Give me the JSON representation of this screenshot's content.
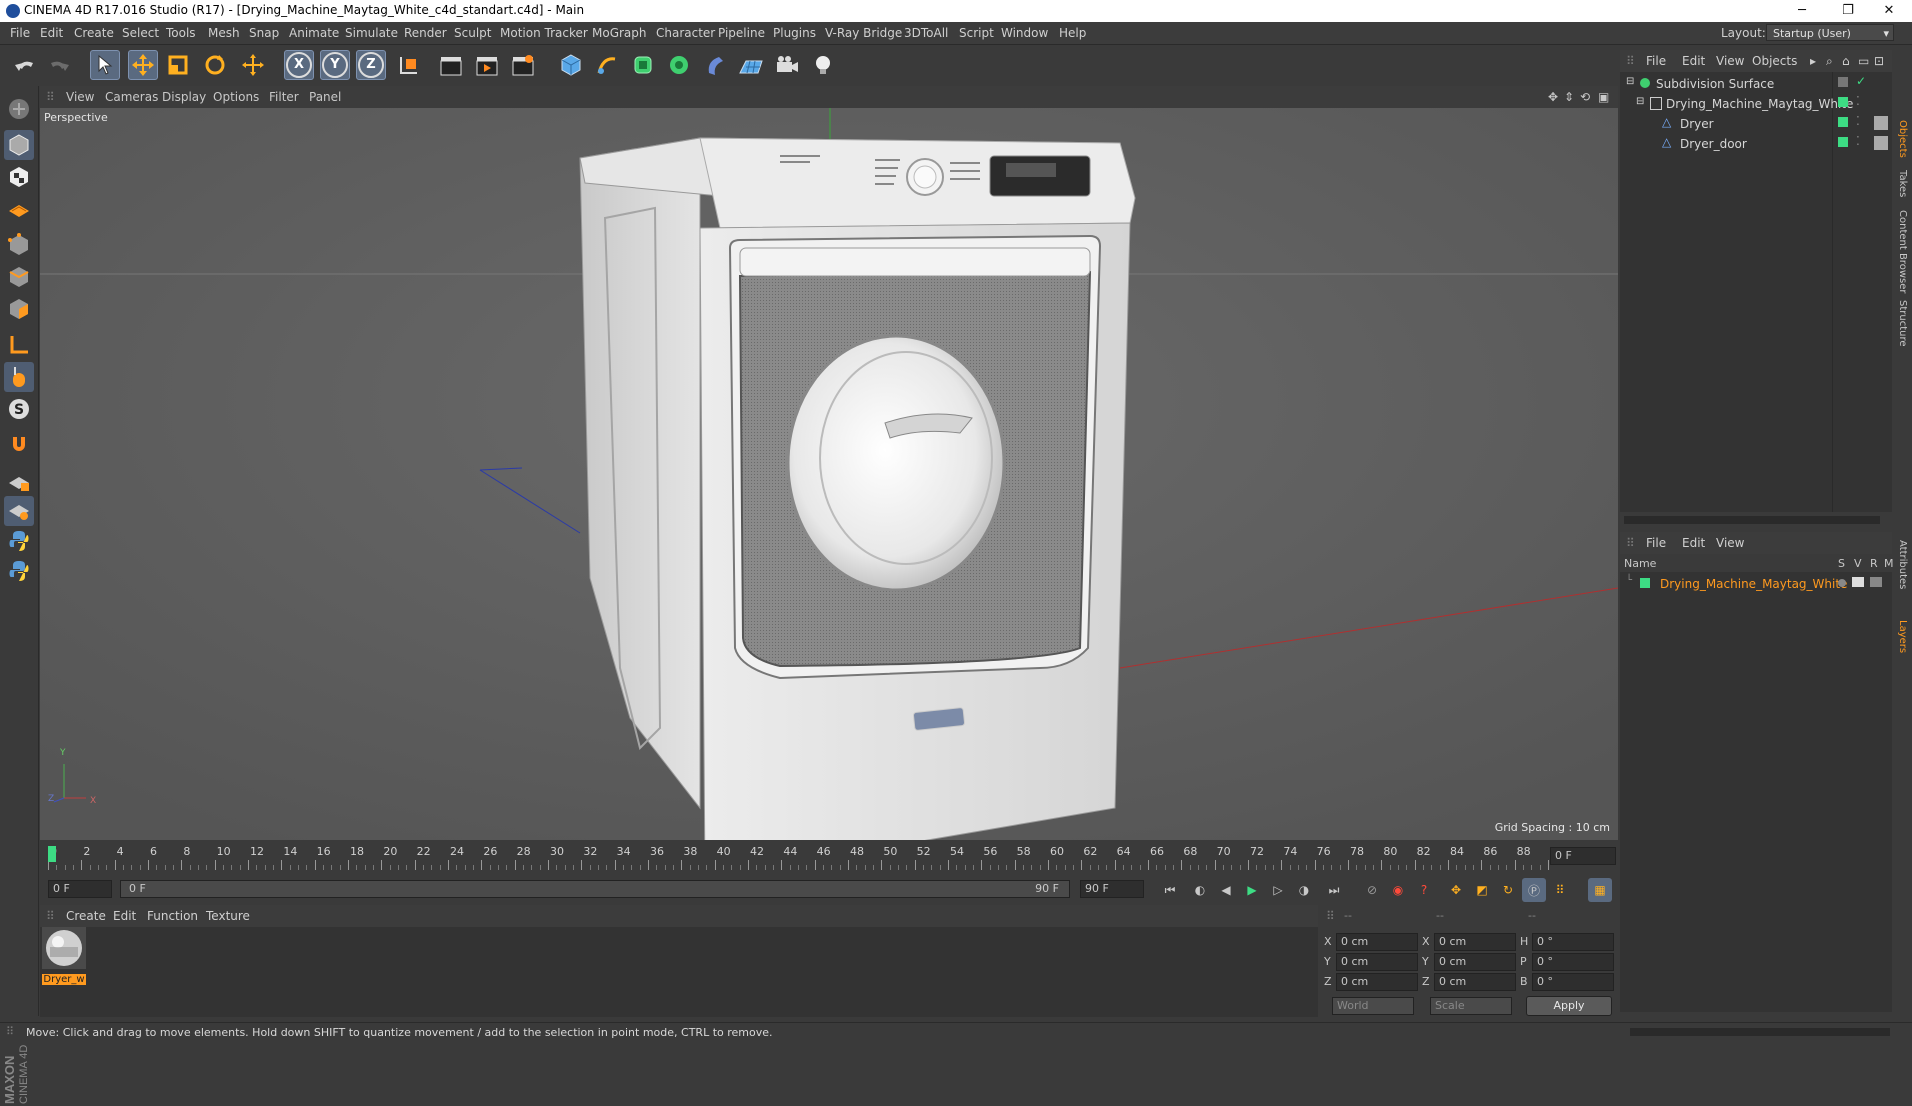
{
  "window": {
    "title": "CINEMA 4D R17.016 Studio (R17) - [Drying_Machine_Maytag_White_c4d_standart.c4d] - Main",
    "controls": [
      "─",
      "❐",
      "✕"
    ]
  },
  "menubar": {
    "items": [
      "File",
      "Edit",
      "Create",
      "Select",
      "Tools",
      "Mesh",
      "Snap",
      "Animate",
      "Simulate",
      "Render",
      "Sculpt",
      "Motion Tracker",
      "MoGraph",
      "Character",
      "Pipeline",
      "Plugins",
      "V-Ray Bridge",
      "3DToAll",
      "Script",
      "Window",
      "Help"
    ],
    "layout_label": "Layout:",
    "layout_value": "Startup (User)"
  },
  "toolbar": {
    "axis_x": "X",
    "axis_y": "Y",
    "axis_z": "Z"
  },
  "viewport": {
    "menu": [
      "View",
      "Cameras",
      "Display",
      "Options",
      "Filter",
      "Panel"
    ],
    "label": "Perspective",
    "grid_spacing": "Grid Spacing : 10 cm",
    "axis_y": "Y",
    "axis_z": "Z",
    "axis_x": "X"
  },
  "timeline": {
    "ticks": [
      "0",
      "2",
      "4",
      "6",
      "8",
      "10",
      "12",
      "14",
      "16",
      "18",
      "20",
      "22",
      "24",
      "26",
      "28",
      "30",
      "32",
      "34",
      "36",
      "38",
      "40",
      "42",
      "44",
      "46",
      "48",
      "50",
      "52",
      "54",
      "56",
      "58",
      "60",
      "62",
      "64",
      "66",
      "68",
      "70",
      "72",
      "74",
      "76",
      "78",
      "80",
      "82",
      "84",
      "86",
      "88",
      "90"
    ],
    "current_frame": "0 F",
    "start_field": "0 F",
    "range_start": "0 F",
    "range_end": "90 F",
    "end_field": "90 F"
  },
  "material_manager": {
    "menu": [
      "Create",
      "Edit",
      "Function",
      "Texture"
    ],
    "materials": [
      {
        "name": "Dryer_w"
      }
    ]
  },
  "coordinates": {
    "headers": [
      "--",
      "--",
      "--"
    ],
    "rows": [
      {
        "a": "X",
        "av": "0 cm",
        "b": "X",
        "bv": "0 cm",
        "c": "H",
        "cv": "0 °"
      },
      {
        "a": "Y",
        "av": "0 cm",
        "b": "Y",
        "bv": "0 cm",
        "c": "P",
        "cv": "0 °"
      },
      {
        "a": "Z",
        "av": "0 cm",
        "b": "Z",
        "bv": "0 cm",
        "c": "B",
        "cv": "0 °"
      }
    ],
    "mode_world": "World",
    "mode_scale": "Scale",
    "apply": "Apply"
  },
  "object_manager": {
    "menu": [
      "File",
      "Edit",
      "View",
      "Objects"
    ],
    "objects": [
      {
        "name": "Subdivision Surface",
        "depth": 0
      },
      {
        "name": "Drying_Machine_Maytag_White",
        "depth": 1
      },
      {
        "name": "Dryer",
        "depth": 2
      },
      {
        "name": "Dryer_door",
        "depth": 2
      }
    ]
  },
  "layer_manager": {
    "menu": [
      "File",
      "Edit",
      "View"
    ],
    "col_name": "Name",
    "col_flags": [
      "S",
      "V",
      "R",
      "M"
    ],
    "layers": [
      {
        "name": "Drying_Machine_Maytag_White",
        "color": "#3ddc84"
      }
    ]
  },
  "side_tabs": [
    "Objects",
    "Takes",
    "Content Browser",
    "Structure",
    "Attributes",
    "Layers"
  ],
  "status": {
    "text": "Move: Click and drag to move elements. Hold down SHIFT to quantize movement / add to the selection in point mode, CTRL to remove."
  },
  "colors": {
    "accent_orange": "#ff9a1f",
    "layer_green": "#3ddc84",
    "selection_blue": "#5a6a80"
  }
}
